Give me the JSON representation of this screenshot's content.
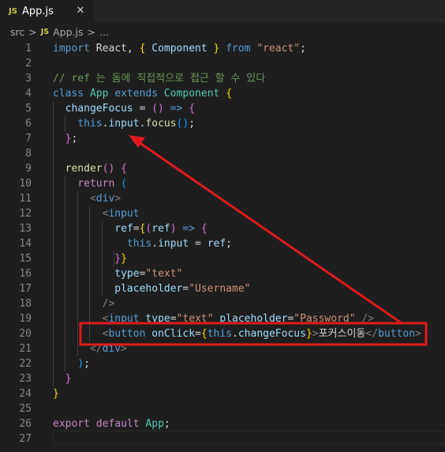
{
  "tab": {
    "badge": "JS",
    "label": "App.js",
    "close": "✕"
  },
  "breadcrumb": {
    "folder": "src",
    "sep": ">",
    "badge": "JS",
    "file": "App.js",
    "more": "..."
  },
  "lines": [
    {
      "n": "1",
      "t": [
        [
          "kw",
          "import"
        ],
        [
          "txt",
          " React, "
        ],
        [
          "br1",
          "{"
        ],
        [
          "txt",
          " "
        ],
        [
          "var",
          "Component"
        ],
        [
          "txt",
          " "
        ],
        [
          "br1",
          "}"
        ],
        [
          "txt",
          " "
        ],
        [
          "kw",
          "from"
        ],
        [
          "txt",
          " "
        ],
        [
          "str",
          "\"react\""
        ],
        [
          "txt",
          ";"
        ]
      ]
    },
    {
      "n": "2",
      "t": []
    },
    {
      "n": "3",
      "t": [
        [
          "cmt",
          "// ref 는 돔에 직접적으로 접근 할 수 있다"
        ]
      ]
    },
    {
      "n": "4",
      "t": [
        [
          "kw",
          "class"
        ],
        [
          "txt",
          " "
        ],
        [
          "cls",
          "App"
        ],
        [
          "txt",
          " "
        ],
        [
          "kw",
          "extends"
        ],
        [
          "txt",
          " "
        ],
        [
          "cls",
          "Component"
        ],
        [
          "txt",
          " "
        ],
        [
          "br1",
          "{"
        ]
      ]
    },
    {
      "n": "5",
      "t": [
        [
          "txt",
          "  "
        ],
        [
          "var",
          "changeFocus"
        ],
        [
          "txt",
          " = "
        ],
        [
          "br2",
          "()"
        ],
        [
          "txt",
          " "
        ],
        [
          "kw",
          "=>"
        ],
        [
          "txt",
          " "
        ],
        [
          "br2",
          "{"
        ]
      ]
    },
    {
      "n": "6",
      "t": [
        [
          "txt",
          "    "
        ],
        [
          "kw",
          "this"
        ],
        [
          "txt",
          "."
        ],
        [
          "var",
          "input"
        ],
        [
          "txt",
          "."
        ],
        [
          "fn",
          "focus"
        ],
        [
          "br3",
          "()"
        ],
        [
          "txt",
          ";"
        ]
      ]
    },
    {
      "n": "7",
      "t": [
        [
          "txt",
          "  "
        ],
        [
          "br2",
          "}"
        ],
        [
          "txt",
          ";"
        ]
      ]
    },
    {
      "n": "8",
      "t": []
    },
    {
      "n": "9",
      "t": [
        [
          "txt",
          "  "
        ],
        [
          "fn",
          "render"
        ],
        [
          "br2",
          "()"
        ],
        [
          "txt",
          " "
        ],
        [
          "br2",
          "{"
        ]
      ]
    },
    {
      "n": "10",
      "t": [
        [
          "txt",
          "    "
        ],
        [
          "ctl",
          "return"
        ],
        [
          "txt",
          " "
        ],
        [
          "br3",
          "("
        ]
      ]
    },
    {
      "n": "11",
      "t": [
        [
          "txt",
          "      "
        ],
        [
          "tag",
          "<"
        ],
        [
          "tagn",
          "div"
        ],
        [
          "tag",
          ">"
        ]
      ]
    },
    {
      "n": "12",
      "t": [
        [
          "txt",
          "        "
        ],
        [
          "tag",
          "<"
        ],
        [
          "tagn",
          "input"
        ]
      ]
    },
    {
      "n": "13",
      "t": [
        [
          "txt",
          "          "
        ],
        [
          "attr",
          "ref"
        ],
        [
          "txt",
          "="
        ],
        [
          "br1",
          "{"
        ],
        [
          "br2",
          "("
        ],
        [
          "var",
          "ref"
        ],
        [
          "br2",
          ")"
        ],
        [
          "txt",
          " "
        ],
        [
          "kw",
          "=>"
        ],
        [
          "txt",
          " "
        ],
        [
          "br2",
          "{"
        ]
      ]
    },
    {
      "n": "14",
      "t": [
        [
          "txt",
          "            "
        ],
        [
          "kw",
          "this"
        ],
        [
          "txt",
          "."
        ],
        [
          "var",
          "input"
        ],
        [
          "txt",
          " = "
        ],
        [
          "var",
          "ref"
        ],
        [
          "txt",
          ";"
        ]
      ]
    },
    {
      "n": "15",
      "t": [
        [
          "txt",
          "          "
        ],
        [
          "br2",
          "}"
        ],
        [
          "br1",
          "}"
        ]
      ]
    },
    {
      "n": "16",
      "t": [
        [
          "txt",
          "          "
        ],
        [
          "attr",
          "type"
        ],
        [
          "txt",
          "="
        ],
        [
          "str",
          "\"text\""
        ]
      ]
    },
    {
      "n": "17",
      "t": [
        [
          "txt",
          "          "
        ],
        [
          "attr",
          "placeholder"
        ],
        [
          "txt",
          "="
        ],
        [
          "str",
          "\"Username\""
        ]
      ]
    },
    {
      "n": "18",
      "t": [
        [
          "txt",
          "        "
        ],
        [
          "tag",
          "/>"
        ]
      ]
    },
    {
      "n": "19",
      "t": [
        [
          "txt",
          "        "
        ],
        [
          "tag",
          "<"
        ],
        [
          "tagn",
          "input"
        ],
        [
          "txt",
          " "
        ],
        [
          "attr",
          "type"
        ],
        [
          "txt",
          "="
        ],
        [
          "str",
          "\"text\""
        ],
        [
          "txt",
          " "
        ],
        [
          "attr",
          "placeholder"
        ],
        [
          "txt",
          "="
        ],
        [
          "str",
          "\"Password\""
        ],
        [
          "txt",
          " "
        ],
        [
          "tag",
          "/>"
        ]
      ]
    },
    {
      "n": "20",
      "t": [
        [
          "txt",
          "        "
        ],
        [
          "tag",
          "<"
        ],
        [
          "tagn",
          "button"
        ],
        [
          "txt",
          " "
        ],
        [
          "attr",
          "onClick"
        ],
        [
          "txt",
          "="
        ],
        [
          "br1",
          "{"
        ],
        [
          "kw",
          "this"
        ],
        [
          "txt",
          "."
        ],
        [
          "var",
          "changeFocus"
        ],
        [
          "br1",
          "}"
        ],
        [
          "tag",
          ">"
        ],
        [
          "txt",
          "포커스이동"
        ],
        [
          "tag",
          "</"
        ],
        [
          "tagn",
          "button"
        ],
        [
          "tag",
          ">"
        ]
      ]
    },
    {
      "n": "21",
      "t": [
        [
          "txt",
          "      "
        ],
        [
          "tag",
          "</"
        ],
        [
          "tagn",
          "div"
        ],
        [
          "tag",
          ">"
        ]
      ]
    },
    {
      "n": "22",
      "t": [
        [
          "txt",
          "    "
        ],
        [
          "br3",
          ")"
        ],
        [
          "txt",
          ";"
        ]
      ]
    },
    {
      "n": "23",
      "t": [
        [
          "txt",
          "  "
        ],
        [
          "br2",
          "}"
        ]
      ]
    },
    {
      "n": "24",
      "t": [
        [
          "br1",
          "}"
        ]
      ]
    },
    {
      "n": "25",
      "t": []
    },
    {
      "n": "26",
      "t": [
        [
          "ctl",
          "export"
        ],
        [
          "txt",
          " "
        ],
        [
          "ctl",
          "default"
        ],
        [
          "txt",
          " "
        ],
        [
          "cls",
          "App"
        ],
        [
          "txt",
          ";"
        ]
      ]
    },
    {
      "n": "27",
      "t": []
    }
  ],
  "colors": {
    "annotation": "#e0191b",
    "background": "#1e1e1e"
  }
}
